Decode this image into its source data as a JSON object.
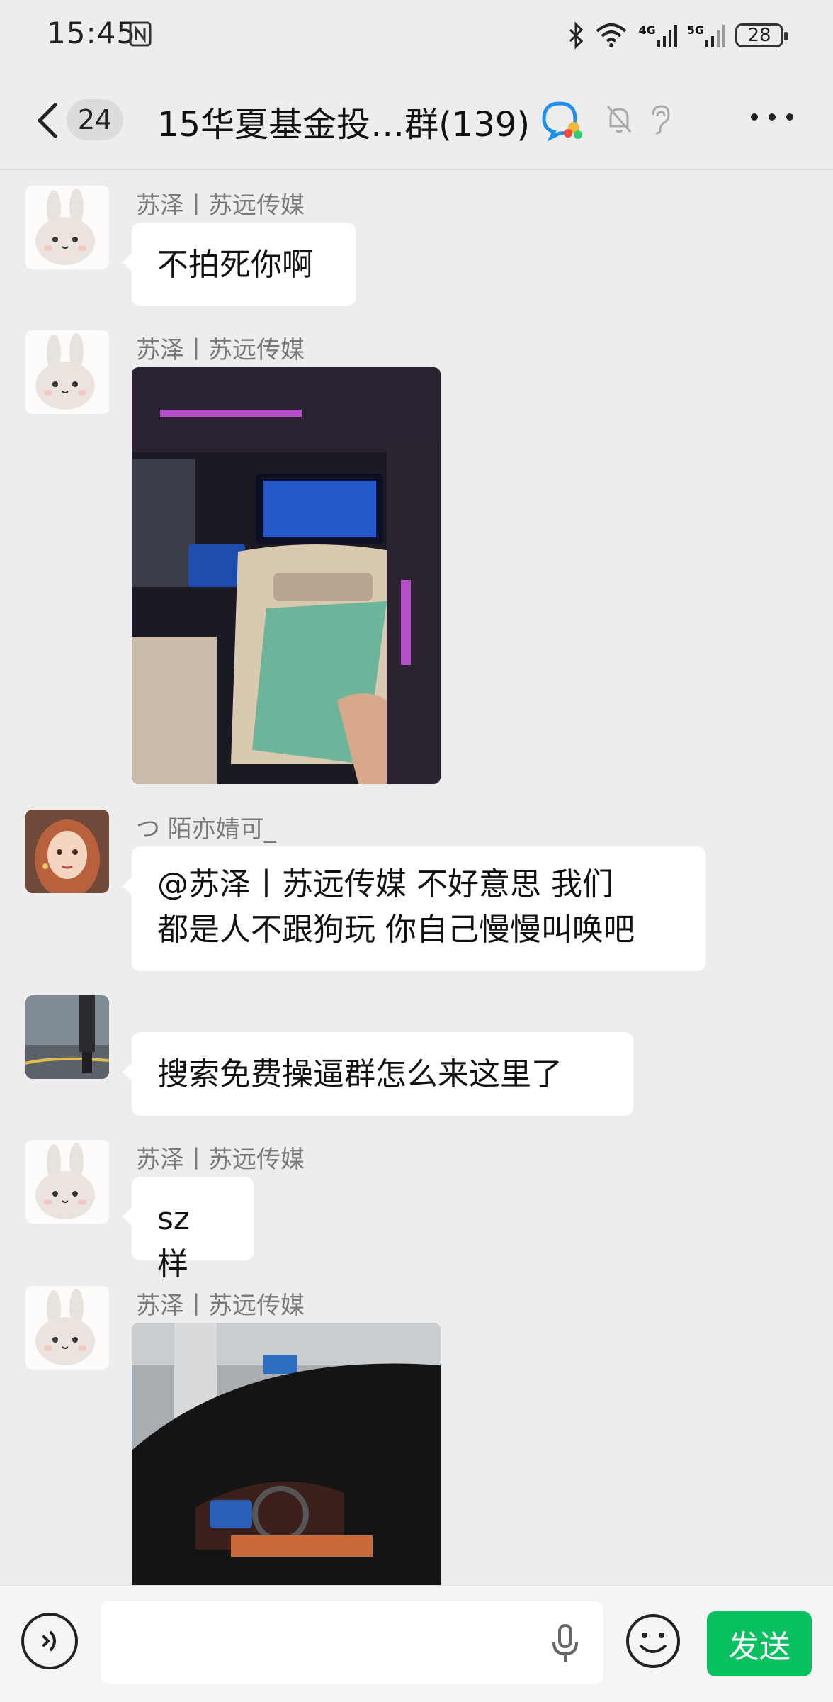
{
  "status_bar": {
    "time": "15:45",
    "network_4g": "4G",
    "network_5g": "5G",
    "battery": "28"
  },
  "header": {
    "unread_count": "24",
    "title": "15华夏基金投…群(139)"
  },
  "messages": [
    {
      "sender": "苏泽丨苏远传媒",
      "type": "text",
      "text": "不拍死你啊"
    },
    {
      "sender": "苏泽丨苏远传媒",
      "type": "image",
      "image_desc": "car-interior-photo"
    },
    {
      "sender": "つ 陌亦婧可_",
      "type": "text",
      "text_line1": "@苏泽丨苏远传媒  不好意思 我们",
      "text_line2": "都是人不跟狗玩 你自己慢慢叫唤吧"
    },
    {
      "sender": "",
      "type": "text",
      "text": "搜索免费操逼群怎么来这里了"
    },
    {
      "sender": "苏泽丨苏远传媒",
      "type": "text",
      "text": "sz 样"
    },
    {
      "sender": "苏泽丨苏远传媒",
      "type": "image",
      "image_desc": "car-parking-photo"
    }
  ],
  "input_bar": {
    "send_label": "发送"
  },
  "colors": {
    "background": "#ededed",
    "send_button": "#07c160",
    "bubble": "#ffffff"
  }
}
